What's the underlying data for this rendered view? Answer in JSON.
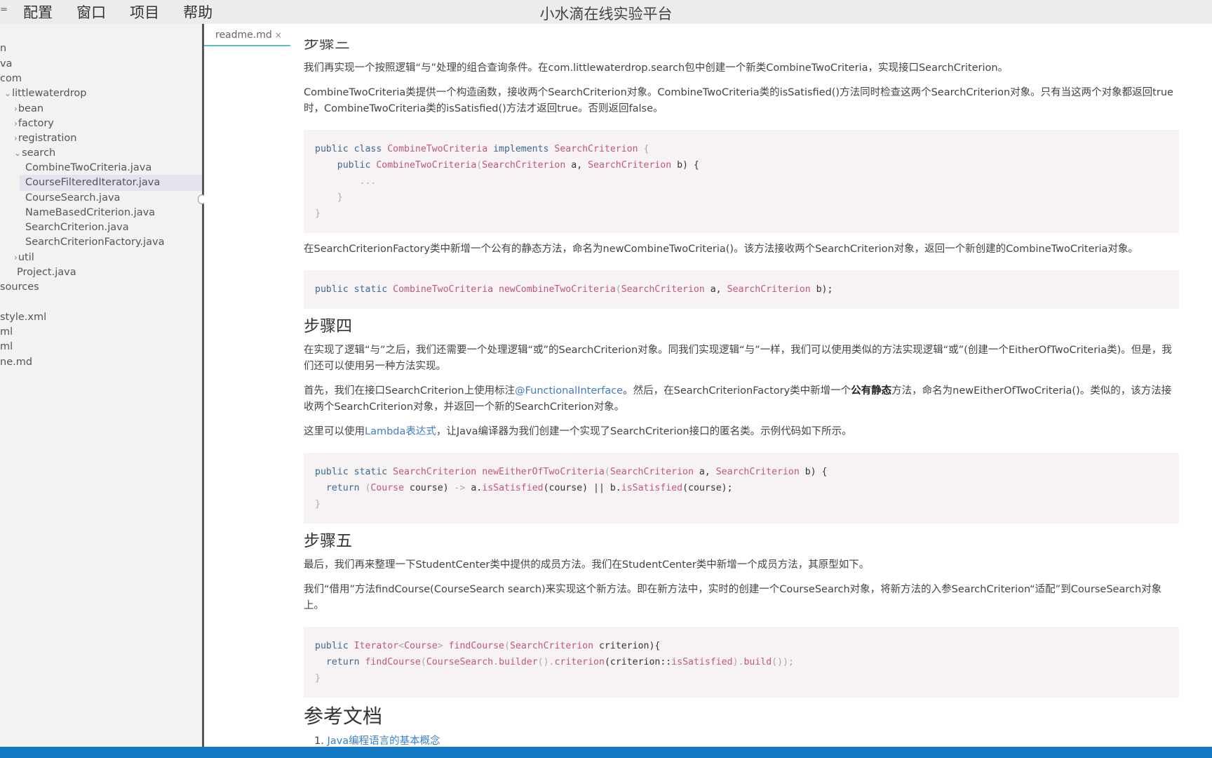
{
  "menubar": {
    "first_item": "⁼",
    "items": [
      "配置",
      "窗口",
      "项目",
      "帮助"
    ],
    "app_title": "小水滴在线实验平台"
  },
  "sidebar": {
    "items": [
      {
        "label": "n",
        "chevron": ""
      },
      {
        "label": "va",
        "chevron": ""
      },
      {
        "label": "com",
        "chevron": ""
      },
      {
        "label": "littlewaterdrop",
        "chevron": "⌄"
      },
      {
        "label": "bean",
        "chevron": "›"
      },
      {
        "label": "factory",
        "chevron": "›"
      },
      {
        "label": "registration",
        "chevron": "›"
      },
      {
        "label": "search",
        "chevron": "⌄"
      },
      {
        "label": "CombineTwoCriteria.java",
        "chevron": ""
      },
      {
        "label": "CourseFilteredIterator.java",
        "chevron": "",
        "selected": true
      },
      {
        "label": "CourseSearch.java",
        "chevron": ""
      },
      {
        "label": "NameBasedCriterion.java",
        "chevron": ""
      },
      {
        "label": "SearchCriterion.java",
        "chevron": ""
      },
      {
        "label": "SearchCriterionFactory.java",
        "chevron": ""
      },
      {
        "label": "util",
        "chevron": "›"
      },
      {
        "label": "Project.java",
        "chevron": ""
      },
      {
        "label": "sources",
        "chevron": ""
      },
      {
        "label": "style.xml",
        "chevron": ""
      },
      {
        "label": "ml",
        "chevron": ""
      },
      {
        "label": "ml",
        "chevron": ""
      },
      {
        "label": "ne.md",
        "chevron": ""
      }
    ]
  },
  "editor": {
    "tab": {
      "label": "readme.md",
      "close": "×"
    },
    "partial_heading": "步骤三",
    "p1": "我们再实现一个按照逻辑“与”处理的组合查询条件。在com.littlewaterdrop.search包中创建一个新类CombineTwoCriteria，实现接口SearchCriterion。",
    "p2": "CombineTwoCriteria类提供一个构造函数，接收两个SearchCriterion对象。CombineTwoCriteria类的isSatisfied()方法同时检查这两个SearchCriterion对象。只有当这两个对象都返回true时，CombineTwoCriteria类的isSatisfied()方法才返回true。否则返回false。",
    "code1": {
      "line1": {
        "kw1": "public class ",
        "ty1": "CombineTwoCriteria",
        "kw2": " implements ",
        "ty2": "SearchCriterion",
        "pl": " {"
      },
      "line2": {
        "kw1": "    public ",
        "fn": "CombineTwoCriteria",
        "pl1": "(",
        "ty1": "SearchCriterion",
        "pl2": " a, ",
        "ty2": "SearchCriterion",
        "pl3": " b) {"
      },
      "line3": "        ...",
      "line4": "    }",
      "line5": "}"
    },
    "p3": "在SearchCriterionFactory类中新增一个公有的静态方法，命名为newCombineTwoCriteria()。该方法接收两个SearchCriterion对象，返回一个新创建的CombineTwoCriteria对象。",
    "code2": {
      "kw": "public static ",
      "ty1": "CombineTwoCriteria",
      "fn": " newCombineTwoCriteria",
      "pl1": "(",
      "ty2": "SearchCriterion",
      "pl2": " a, ",
      "ty3": "SearchCriterion",
      "pl3": " b);"
    },
    "step4_title": "步骤四",
    "p4": "在实现了逻辑“与”之后，我们还需要一个处理逻辑“或”的SearchCriterion对象。同我们实现逻辑“与”一样，我们可以使用类似的方法实现逻辑“或”(创建一个EitherOfTwoCriteria类)。但是，我们还可以使用另一种方法实现。",
    "p5": {
      "a": "首先，我们在接口SearchCriterion上使用标注",
      "link": "@FunctionalInterface",
      "b": "。然后，在SearchCriterionFactory类中新增一个",
      "bold": "公有静态",
      "c": "方法，命名为newEitherOfTwoCriteria()。类似的，该方法接收两个SearchCriterion对象，并返回一个新的SearchCriterion对象。"
    },
    "p6": {
      "a": "这里可以使用",
      "link": "Lambda表达式",
      "b": "，让Java编译器为我们创建一个实现了SearchCriterion接口的匿名类。示例代码如下所示。"
    },
    "code3": {
      "line1": {
        "kw": "public static ",
        "ty1": "SearchCriterion",
        "fn": " newEitherOfTwoCriteria",
        "pl1": "(",
        "ty2": "SearchCriterion",
        "pl2": " a, ",
        "ty3": "SearchCriterion",
        "pl3": " b) {"
      },
      "line2": {
        "kw": "  return ",
        "pl1": "(",
        "ty": "Course",
        "pl2": " course) ",
        "op": "->",
        "pl3": " a.",
        "fn1": "isSatisfied",
        "pl4": "(course) || b.",
        "fn2": "isSatisfied",
        "pl5": "(course);"
      },
      "line3": "}"
    },
    "step5_title": "步骤五",
    "p7": "最后，我们再来整理一下StudentCenter类中提供的成员方法。我们在StudentCenter类中新增一个成员方法，其原型如下。",
    "p8": "我们“借用”方法findCourse(CourseSearch search)来实现这个新方法。即在新方法中，实时的创建一个CourseSearch对象，将新方法的入参SearchCriterion“适配”到CourseSearch对象上。",
    "code4": {
      "line1": {
        "kw": "public ",
        "ty1": "Iterator",
        "pl1": "<",
        "ty2": "Course",
        "pl2": "> ",
        "fn": "findCourse",
        "pl3": "(",
        "ty3": "SearchCriterion",
        "pl4": " criterion){"
      },
      "line2": {
        "kw": "  return ",
        "fn1": "findCourse",
        "pl1": "(",
        "ty": "CourseSearch",
        "pl2": ".",
        "fn2": "builder",
        "pl3": "().",
        "fn3": "criterion",
        "pl4": "(criterion::",
        "fn4": "isSatisfied",
        "pl5": ").",
        "fn5": "build",
        "pl6": "());"
      },
      "line3": "}"
    },
    "ref_title": "参考文档",
    "references": [
      {
        "num": "1.",
        "label": "Java编程语言的基本概念"
      }
    ]
  },
  "colors": {
    "accent": "#1479c5",
    "tab_underline": "#5bbfbf",
    "link": "#3d7ec6",
    "code_bg": "#f7f2f3"
  }
}
